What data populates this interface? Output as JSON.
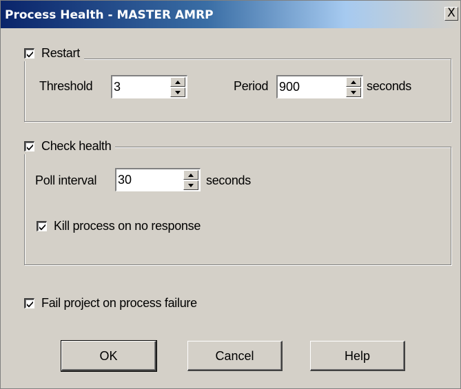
{
  "window": {
    "title": "Process Health - MASTER AMRP",
    "close_glyph": "X"
  },
  "restart": {
    "label": "Restart",
    "checked": true,
    "threshold_label": "Threshold",
    "threshold_value": "3",
    "period_label": "Period",
    "period_value": "900",
    "period_unit": "seconds"
  },
  "check_health": {
    "label": "Check health",
    "checked": true,
    "poll_interval_label": "Poll interval",
    "poll_interval_value": "30",
    "poll_interval_unit": "seconds",
    "kill_label": "Kill process on no response",
    "kill_checked": true
  },
  "fail_project": {
    "label": "Fail project on process failure",
    "checked": true
  },
  "buttons": {
    "ok": "OK",
    "cancel": "Cancel",
    "help": "Help"
  },
  "colors": {
    "dialog_bg": "#d4d0c8",
    "title_start": "#0a246a",
    "title_end": "#a6caf0"
  }
}
